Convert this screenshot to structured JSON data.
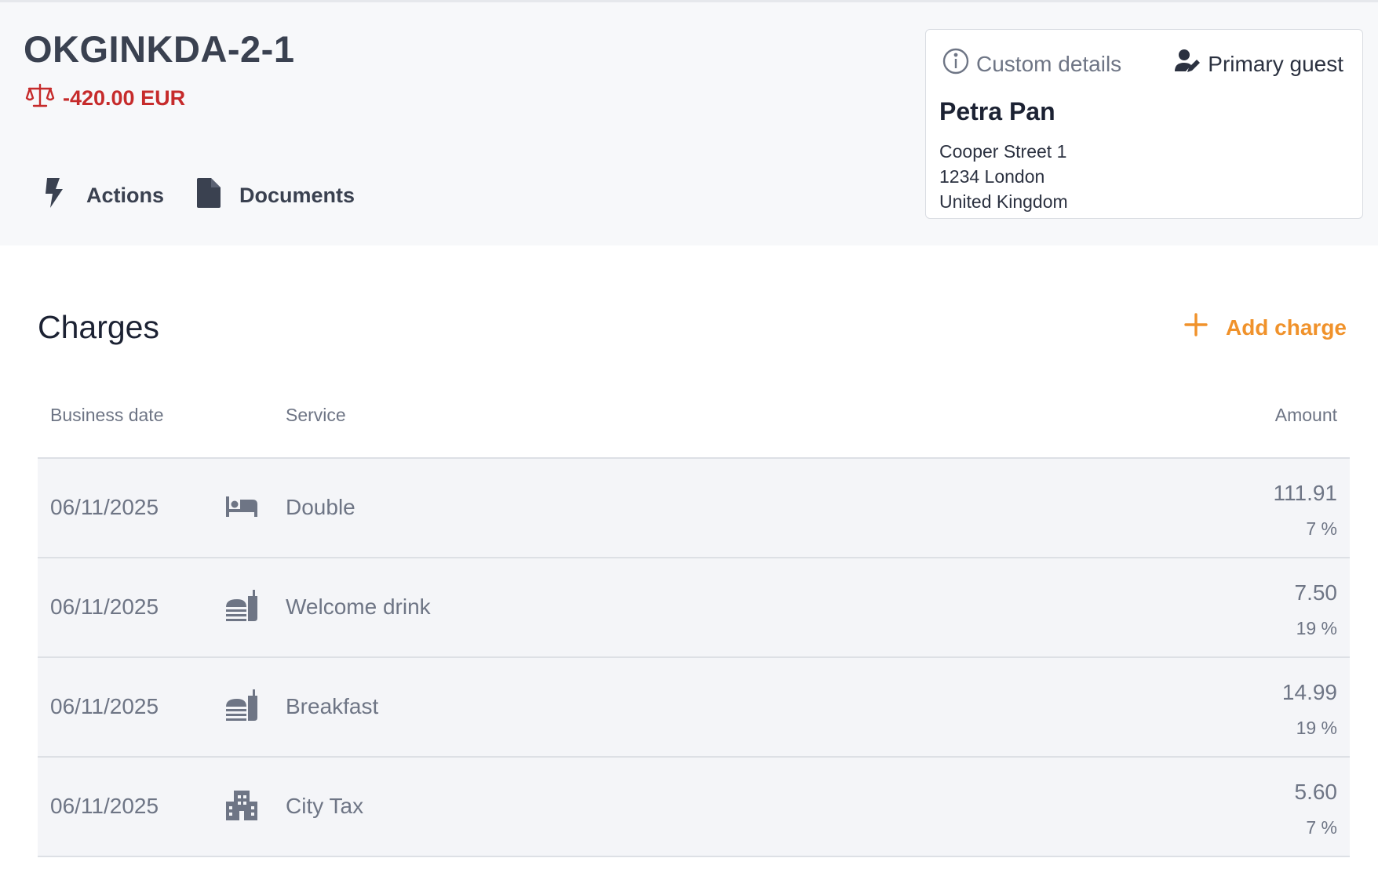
{
  "folio": {
    "title": "OKGINKDA-2-1",
    "balance": "-420.00 EUR",
    "balance_color": "#c62b2b",
    "balance_icon": "scale-icon"
  },
  "header_actions": [
    {
      "label": "Actions",
      "icon": "lightning-icon"
    },
    {
      "label": "Documents",
      "icon": "document-icon"
    }
  ],
  "guest_card": {
    "custom_details_label": "Custom details",
    "primary_guest_label": "Primary guest",
    "name": "Petra Pan",
    "address_line1": "Cooper Street 1",
    "address_line2": "1234 London",
    "country": "United Kingdom"
  },
  "charges": {
    "title": "Charges",
    "add_label": "Add charge",
    "accent_color": "#f0922b",
    "columns": {
      "business_date": "Business date",
      "service": "Service",
      "amount": "Amount"
    },
    "rows": [
      {
        "date": "06/11/2025",
        "icon": "bed-icon",
        "service": "Double",
        "amount": "111.91",
        "tax": "7 %"
      },
      {
        "date": "06/11/2025",
        "icon": "food-icon",
        "service": "Welcome drink",
        "amount": "7.50",
        "tax": "19 %"
      },
      {
        "date": "06/11/2025",
        "icon": "food-icon",
        "service": "Breakfast",
        "amount": "14.99",
        "tax": "19 %"
      },
      {
        "date": "06/11/2025",
        "icon": "city-icon",
        "service": "City Tax",
        "amount": "5.60",
        "tax": "7 %"
      }
    ]
  }
}
